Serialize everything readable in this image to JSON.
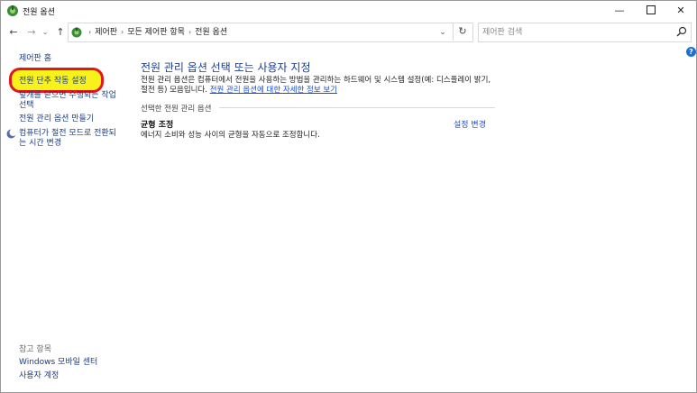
{
  "window": {
    "title": "전원 옵션",
    "minimize": "—",
    "close": "✕"
  },
  "nav": {
    "back": "←",
    "forward": "→",
    "recent": "⌄",
    "up": "↑",
    "refresh": "↻",
    "dropdown": "⌄"
  },
  "breadcrumb": {
    "sep": "›",
    "items": [
      "제어판",
      "모든 제어판 항목",
      "전원 옵션"
    ]
  },
  "search": {
    "placeholder": "제어판 검색"
  },
  "help": "?",
  "sidebar": {
    "home": "제어판 홈",
    "power_buttons": "전원 단추 작동 설정",
    "lid": "덮개를 닫으면 수행되는 작업 선택",
    "create_plan": "전원 관리 옵션 만들기",
    "sleep": "컴퓨터가 절전 모드로 전환되는 시간 변경",
    "see_also": "참고 항목",
    "mobility": "Windows 모바일 센터",
    "accounts": "사용자 계정"
  },
  "main": {
    "title": "전원 관리 옵션 선택 또는 사용자 지정",
    "desc": "전원 관리 옵션은 컴퓨터에서 전원을 사용하는 방법을 관리하는 하드웨어 및 시스템 설정(예: 디스플레이 밝기, 절전 등) 모음입니다.",
    "learn_more": "전원 관리 옵션에 대한 자세한 정보 보기",
    "section_label": "선택한 전원 관리 옵션",
    "plan_name": "균형 조정",
    "plan_desc": "에너지 소비와 성능 사이의 균형을 자동으로 조정합니다.",
    "change_settings": "설정 변경"
  },
  "colors": {
    "link": "#1a4fd6",
    "nav_link": "#1e3c7b",
    "highlight_fill": "#f7f31a",
    "highlight_border": "#e3161b"
  }
}
